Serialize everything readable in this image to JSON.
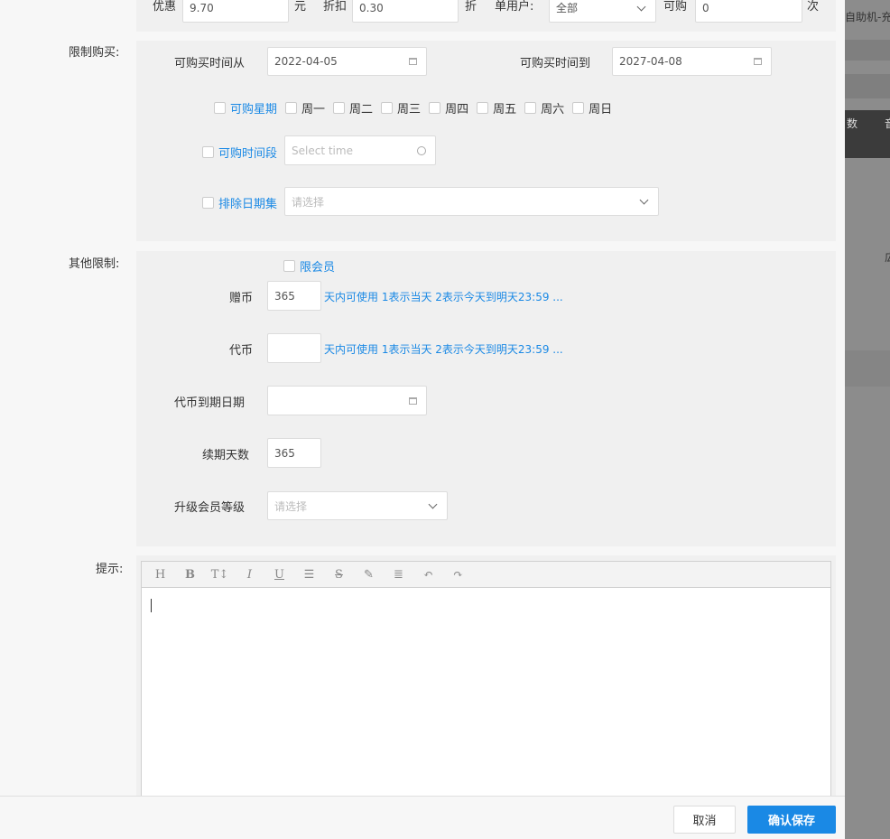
{
  "top_row": {
    "discount_label": "优惠",
    "discount_value": "9.70",
    "yuan_unit": "元",
    "rate_label": "折扣",
    "rate_value": "0.30",
    "rate_unit": "折",
    "per_user_label": "单用户:",
    "per_user_value": "全部",
    "purchasable_label": "可购",
    "purchasable_value": "0",
    "times_unit": "次"
  },
  "purchase_limit": {
    "section_label": "限制购买:",
    "from_label": "可购买时间从",
    "from_value": "2022-04-05",
    "to_label": "可购买时间到",
    "to_value": "2027-04-08",
    "weekday_checkbox_label": "可购星期",
    "weekdays": [
      "周一",
      "周二",
      "周三",
      "周四",
      "周五",
      "周六",
      "周日"
    ],
    "time_period_label": "可购时间段",
    "time_placeholder": "Select time",
    "exclude_dates_label": "排除日期集",
    "exclude_placeholder": "请选择"
  },
  "other_limit": {
    "section_label": "其他限制:",
    "member_only_label": "限会员",
    "bonus_coin_label": "赠币",
    "bonus_coin_value": "365",
    "validity_hint": "天内可使用 1表示当天 2表示今天到明天23:59 ...",
    "token_label": "代币",
    "token_value": "",
    "token_hint": "天内可使用 1表示当天 2表示今天到明天23:59 ...",
    "token_expiry_label": "代币到期日期",
    "renew_days_label": "续期天数",
    "renew_days_value": "365",
    "upgrade_level_label": "升级会员等级",
    "upgrade_placeholder": "请选择"
  },
  "tips": {
    "section_label": "提示:",
    "toolbar": [
      {
        "icon": "heading-icon",
        "glyph": "H"
      },
      {
        "icon": "bold-icon",
        "glyph": "B"
      },
      {
        "icon": "font-size-icon",
        "glyph": "T↕"
      },
      {
        "icon": "italic-icon",
        "glyph": "I"
      },
      {
        "icon": "underline-icon",
        "glyph": "U"
      },
      {
        "icon": "list-icon",
        "glyph": "☰"
      },
      {
        "icon": "strikethrough-icon",
        "glyph": "S"
      },
      {
        "icon": "highlight-icon",
        "glyph": "✎"
      },
      {
        "icon": "align-icon",
        "glyph": "≣"
      },
      {
        "icon": "undo-icon",
        "glyph": "↶"
      },
      {
        "icon": "redo-icon",
        "glyph": "↷"
      }
    ]
  },
  "footer": {
    "cancel_label": "取消",
    "save_label": "确认保存"
  },
  "background": {
    "title_fragment": "自助机-充",
    "col_a": "数",
    "col_b": "音",
    "row_text": "広"
  },
  "colors": {
    "accent": "#1a89e5",
    "panel": "#f0f0f0",
    "drawer": "#f7f7f7",
    "overlay": "#8c8c8c"
  }
}
